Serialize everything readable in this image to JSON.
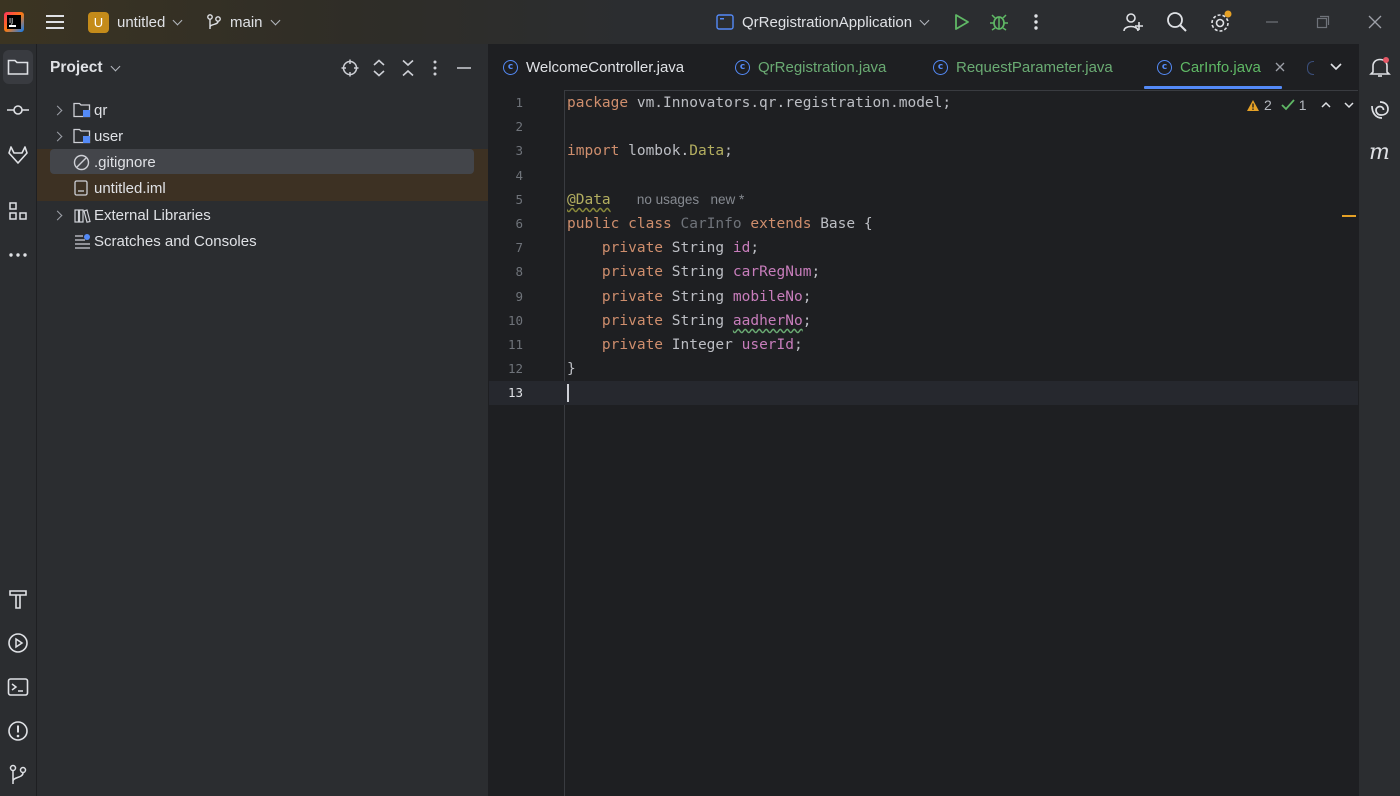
{
  "titlebar": {
    "project_badge": "U",
    "project_name": "untitled",
    "branch": "main",
    "run_config": "QrRegistrationApplication"
  },
  "project_panel": {
    "title": "Project",
    "items": [
      {
        "label": "qr",
        "type": "module-folder",
        "expandable": true
      },
      {
        "label": "user",
        "type": "module-folder",
        "expandable": true
      },
      {
        "label": ".gitignore",
        "type": "ignored-file",
        "expandable": false,
        "selected": true
      },
      {
        "label": "untitled.iml",
        "type": "file",
        "expandable": false
      },
      {
        "label": "External Libraries",
        "type": "library",
        "expandable": true
      },
      {
        "label": "Scratches and Consoles",
        "type": "scratches",
        "expandable": false
      }
    ]
  },
  "editor": {
    "tabs": [
      {
        "label": "WelcomeController.java",
        "active": false
      },
      {
        "label": "QrRegistration.java",
        "active": false
      },
      {
        "label": "RequestParameter.java",
        "active": false
      },
      {
        "label": "CarInfo.java",
        "active": true
      }
    ],
    "inspection": {
      "warnings": "2",
      "ok": "1"
    },
    "line_numbers": [
      "1",
      "2",
      "3",
      "4",
      "5",
      "6",
      "7",
      "8",
      "9",
      "10",
      "11",
      "12",
      "13"
    ],
    "code": {
      "l1_kw": "package",
      "l1_rest": " vm.Innovators.qr.registration.model;",
      "l3_kw": "import",
      "l3_a": " lombok.",
      "l3_b": "Data",
      "l3_c": ";",
      "l5_ann": "@Data",
      "l5_hint1": "no usages",
      "l5_hint2": "new *",
      "l6_kw1": "public",
      "l6_kw2": "class",
      "l6_cls": "CarInfo",
      "l6_kw3": "extends",
      "l6_rest": " Base {",
      "priv": "private",
      "fields": [
        {
          "type": "String",
          "name": "id"
        },
        {
          "type": "String",
          "name": "carRegNum"
        },
        {
          "type": "String",
          "name": "mobileNo"
        },
        {
          "type": "String",
          "name": "aadherNo"
        },
        {
          "type": "Integer",
          "name": "userId"
        }
      ],
      "l12": "}",
      "semicolon": ";"
    }
  },
  "colors": {
    "keyword": "#cf8e6d",
    "field": "#c77dbb",
    "annotation": "#b3ae60",
    "active_tab_text": "#5fb865",
    "tab_text": "#dfe1e5",
    "modified_tab_text": "#6aab73",
    "accent": "#548af7"
  }
}
